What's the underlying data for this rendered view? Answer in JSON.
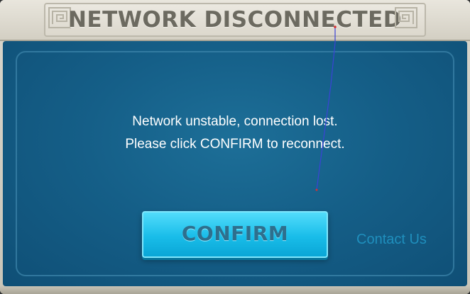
{
  "dialog": {
    "title": "NETWORK DISCONNECTED",
    "message_line1": "Network unstable, connection lost.",
    "message_line2": "Please click CONFIRM to reconnect.",
    "confirm_label": "CONFIRM",
    "contact_label": "Contact Us"
  },
  "colors": {
    "header_bg": "#dcd8cd",
    "title_text": "#6c6a60",
    "panel_bg": "#155f88",
    "confirm_bg": "#19bde9",
    "confirm_text": "#2e6f8d",
    "contact_text": "#1f8fbd",
    "message_text": "#ffffff"
  },
  "icons": {
    "header_left": "greek-key-ornament-icon",
    "header_right": "greek-key-ornament-icon"
  }
}
